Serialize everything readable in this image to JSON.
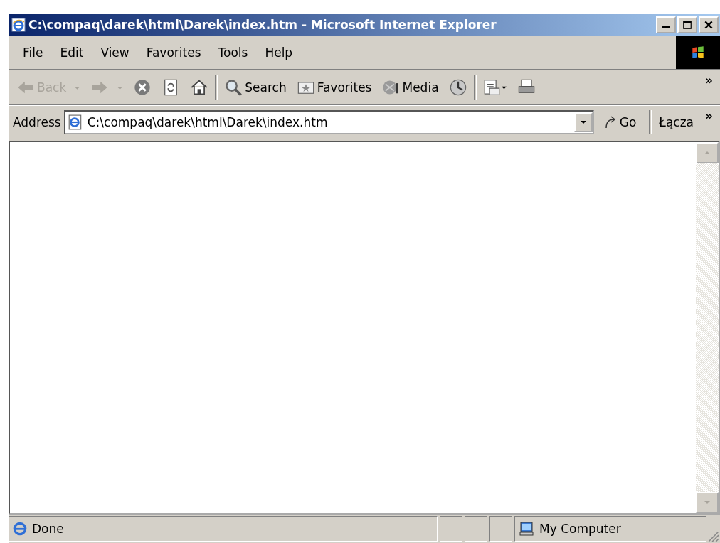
{
  "window": {
    "title": "C:\\compaq\\darek\\html\\Darek\\index.htm - Microsoft Internet Explorer"
  },
  "menu": [
    "File",
    "Edit",
    "View",
    "Favorites",
    "Tools",
    "Help"
  ],
  "toolbar": [
    {
      "kind": "back",
      "label": "Back",
      "disabled": true
    },
    {
      "kind": "forward",
      "disabled": true
    },
    {
      "kind": "stop"
    },
    {
      "kind": "refresh"
    },
    {
      "kind": "home"
    },
    {
      "kind": "separator"
    },
    {
      "kind": "search",
      "label": "Search"
    },
    {
      "kind": "favorites",
      "label": "Favorites"
    },
    {
      "kind": "media",
      "label": "Media"
    },
    {
      "kind": "history"
    },
    {
      "kind": "separator"
    },
    {
      "kind": "mail"
    },
    {
      "kind": "print"
    }
  ],
  "toolbar_more": "»",
  "address_bar": {
    "label": "Address",
    "value": "C:\\compaq\\darek\\html\\Darek\\index.htm",
    "go": "Go",
    "links": "Łącza",
    "links_more": "»"
  },
  "status_bar": {
    "text": "Done",
    "zone": "My Computer"
  }
}
